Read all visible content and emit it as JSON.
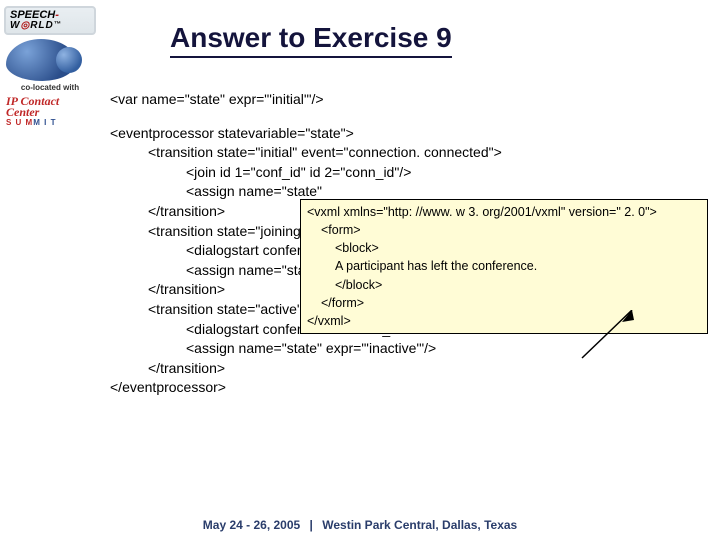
{
  "logo": {
    "part1": "SPEECH",
    "part2": "W",
    "part3": "RLD",
    "tm": "™"
  },
  "coloc": "co-located with",
  "ipcc": {
    "line1": "IP Contact Center",
    "line2a": "S U M",
    "line2b": "M I T"
  },
  "title": "Answer to Exercise 9",
  "code": {
    "l1": "<var name=\"state\" expr=\"'initial'\"/>",
    "l2": "<eventprocessor statevariable=\"state\">",
    "l3": "<transition state=\"initial\" event=\"connection. connected\">",
    "l4": "<join id 1=\"conf_id\" id 2=\"conn_id\"/>",
    "l5": "<assign name=\"state\"",
    "l6": "</transition>",
    "l7": "<transition state=\"joining",
    "l8": "<dialogstart conferenc",
    "l9": "<assign name=\"state\"",
    "l10": "</transition>",
    "l11": "<transition state=\"active\" event=\"connection. disconnected\">",
    "l12": "<dialogstart conferenceid=\"conf_id\" src=\"'callerleft. vxml'\"/>",
    "l13": "<assign name=\"state\" expr=\"'inactive'\"/>",
    "l14": "</transition>",
    "l15": "</eventprocessor>"
  },
  "popup": {
    "p1": "<vxml xmlns=\"http: //www. w 3. org/2001/vxml\" version=\" 2. 0\">",
    "p2": "<form>",
    "p3": "<block>",
    "p4": "A participant has left the conference.",
    "p5": "</block>",
    "p6": "</form>",
    "p7": "</vxml>"
  },
  "footer": {
    "date": "May 24 - 26, 2005",
    "loc": "Westin Park Central, Dallas, Texas"
  }
}
